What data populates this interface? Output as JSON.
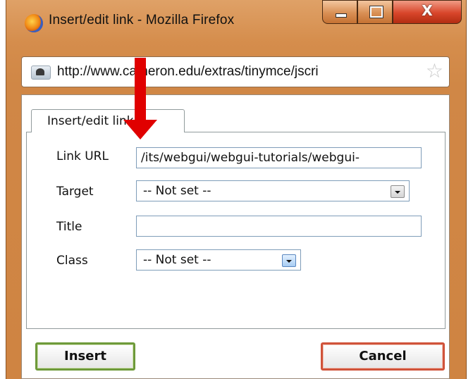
{
  "window": {
    "title": "Insert/edit link - Mozilla Firefox",
    "close_glyph": "X"
  },
  "address_bar": {
    "url": "http://www.cameron.edu/extras/tinymce/jscri"
  },
  "tab": {
    "label": "Insert/edit link"
  },
  "form": {
    "link_url": {
      "label": "Link URL",
      "value": "/its/webgui/webgui-tutorials/webgui-"
    },
    "target": {
      "label": "Target",
      "selected": "-- Not set --"
    },
    "title": {
      "label": "Title",
      "value": ""
    },
    "class": {
      "label": "Class",
      "selected": "-- Not set --"
    }
  },
  "buttons": {
    "insert": "Insert",
    "cancel": "Cancel"
  },
  "colors": {
    "frame": "#d58d4c",
    "insert_border": "#6e9a3a",
    "cancel_border": "#d0533a",
    "annotation_arrow": "#e00000"
  },
  "icons": [
    "firefox-icon",
    "minimize-icon",
    "maximize-icon",
    "close-icon",
    "site-identity-icon",
    "bookmark-star-icon",
    "dropdown-arrow-icon"
  ]
}
